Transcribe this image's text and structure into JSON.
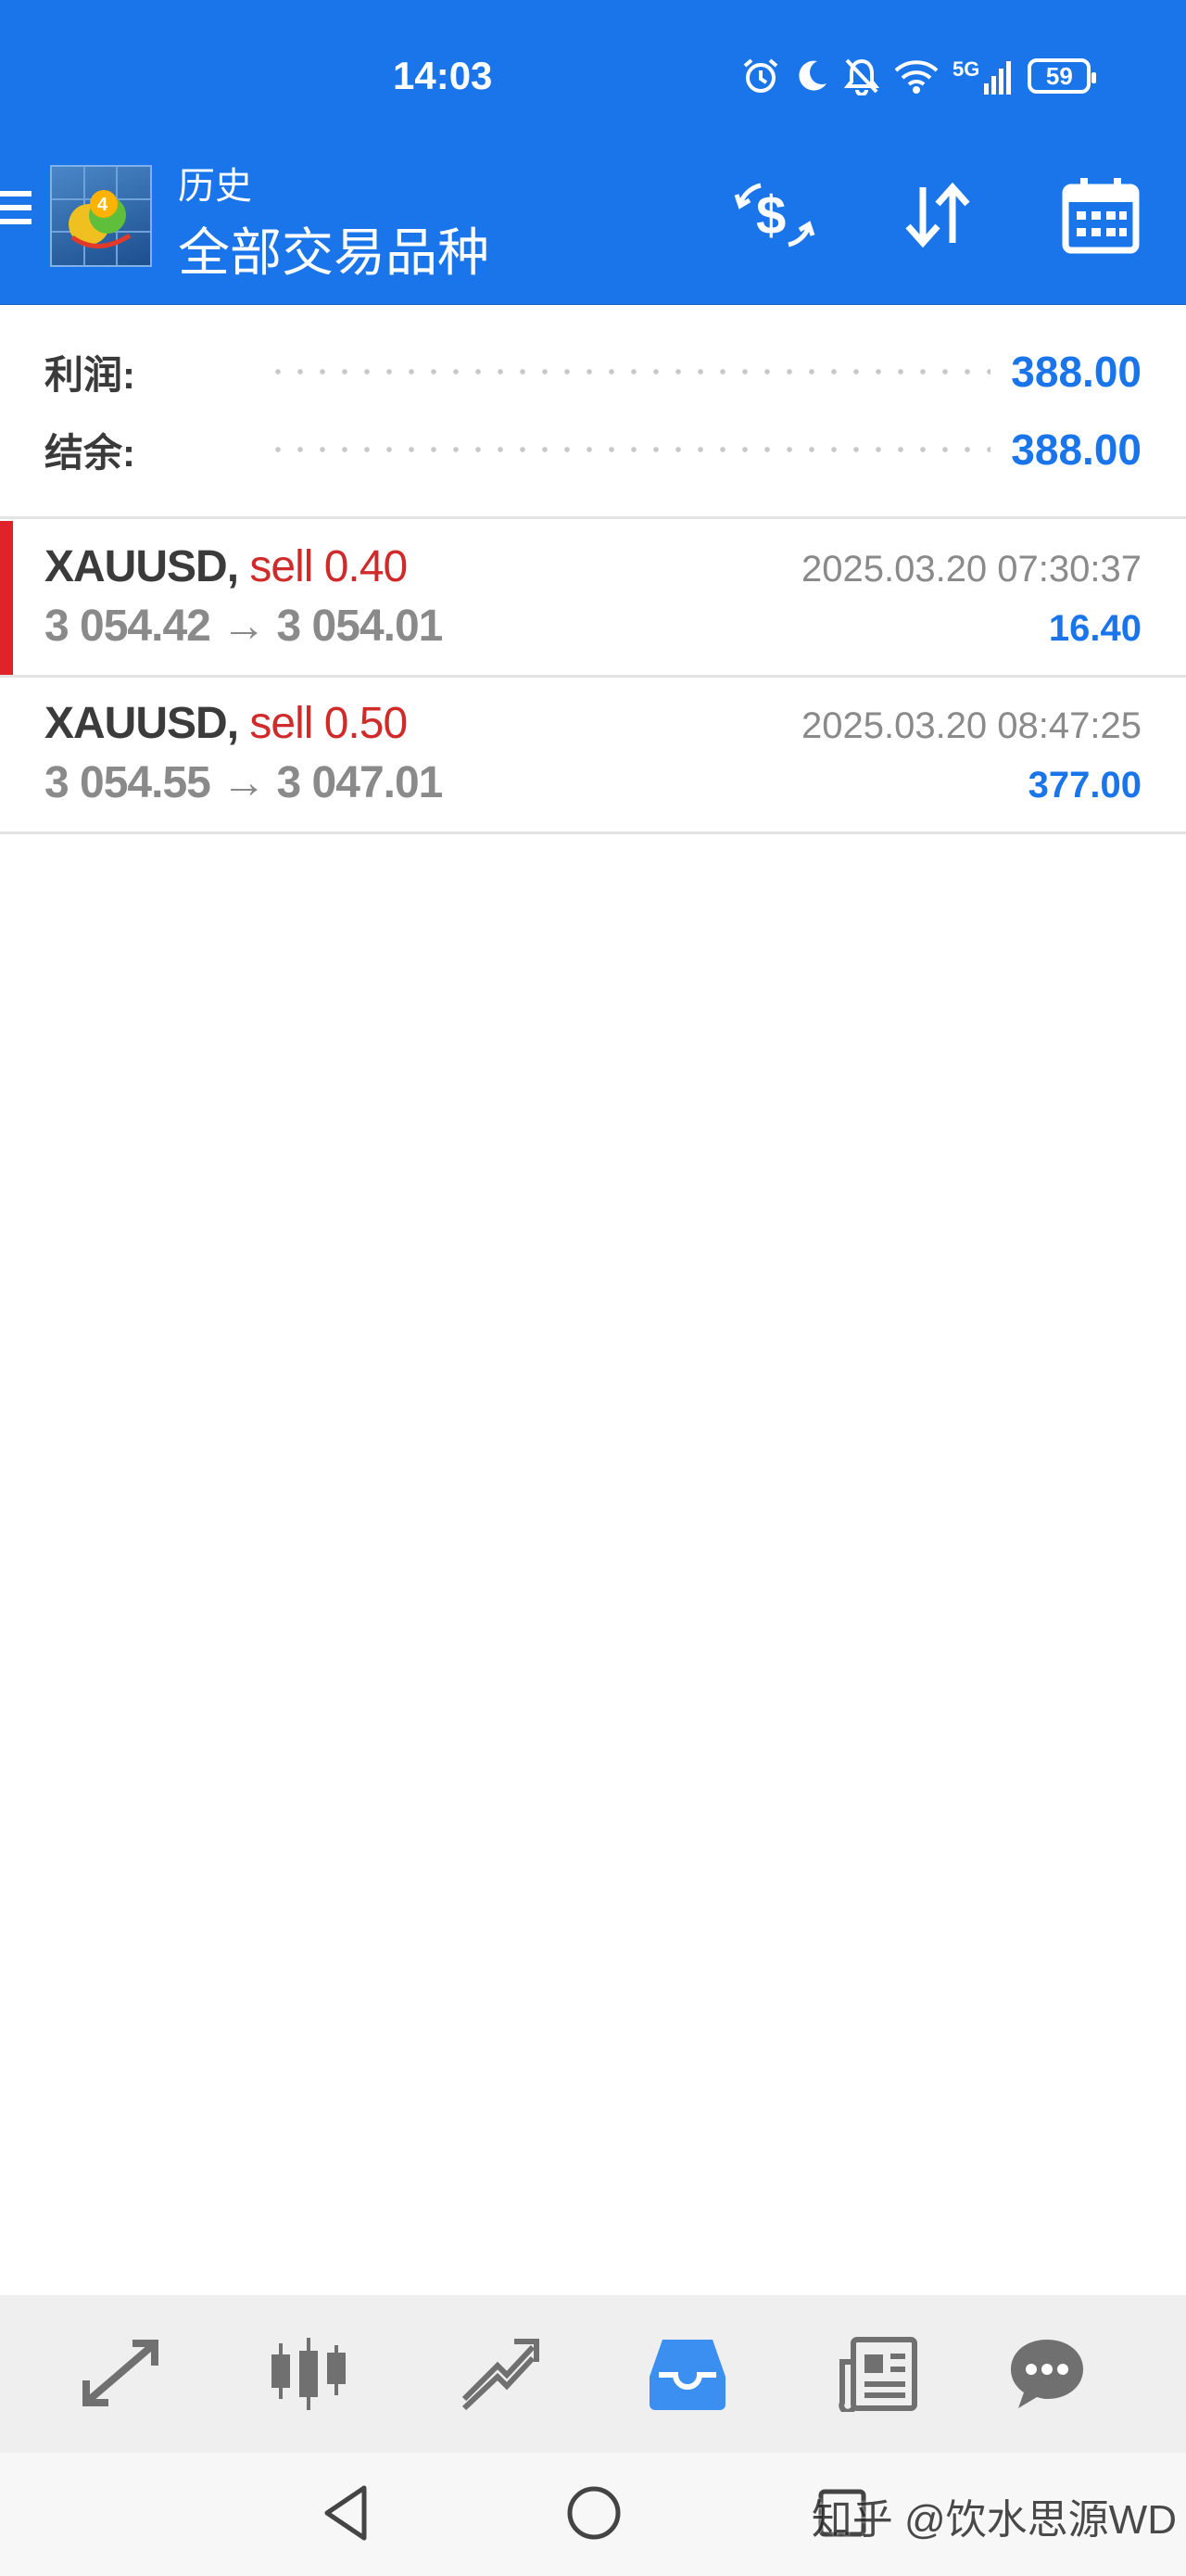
{
  "status_bar": {
    "time": "14:03",
    "network": "5G",
    "battery": "59",
    "icons": [
      "alarm-icon",
      "moon-icon",
      "bell-off-icon",
      "wifi-icon",
      "signal-icon",
      "battery-icon"
    ]
  },
  "app_bar": {
    "title": "历史",
    "subtitle": "全部交易品种",
    "actions": [
      "currency-exchange-icon",
      "sort-icon",
      "calendar-icon"
    ]
  },
  "summary": {
    "profit_label": "利润:",
    "profit_value": "388.00",
    "balance_label": "结余:",
    "balance_value": "388.00"
  },
  "trades": [
    {
      "symbol": "XAUUSD,",
      "side": "sell 0.40",
      "prices": "3 054.42 → 3 054.01",
      "time": "2025.03.20 07:30:37",
      "profit": "16.40"
    },
    {
      "symbol": "XAUUSD,",
      "side": "sell 0.50",
      "prices": "3 054.55 → 3 047.01",
      "time": "2025.03.20 08:47:25",
      "profit": "377.00"
    }
  ],
  "bottom_nav": [
    "quotes-icon",
    "chart-icon",
    "trade-icon",
    "history-icon",
    "news-icon",
    "chat-icon"
  ],
  "colors": {
    "accent": "#1a74ea",
    "sell": "#d02a2a",
    "marker": "#e0232a"
  },
  "watermark": "知乎 @饮水思源WD"
}
